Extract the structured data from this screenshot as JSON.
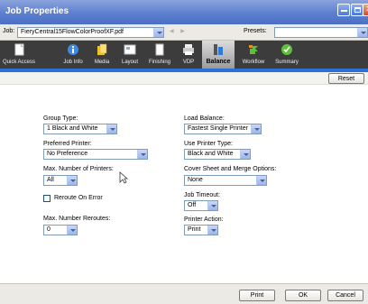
{
  "window": {
    "title": "Job Properties"
  },
  "jobrow": {
    "job_label": "Job:",
    "job_value": "FieryCentral15FlowColorProofXF.pdf",
    "presets_label": "Presets:",
    "presets_value": ""
  },
  "toolbar": {
    "tabs": [
      {
        "label": "Quick Access",
        "icon": "quick-access-icon"
      },
      {
        "label": "Job Info",
        "icon": "info-icon"
      },
      {
        "label": "Media",
        "icon": "media-icon"
      },
      {
        "label": "Layout",
        "icon": "layout-icon"
      },
      {
        "label": "Finishing",
        "icon": "finishing-icon"
      },
      {
        "label": "VDP",
        "icon": "printer-icon"
      },
      {
        "label": "Balance",
        "icon": "balance-icon",
        "active": true
      },
      {
        "label": "Workflow",
        "icon": "workflow-icon"
      },
      {
        "label": "Summary",
        "icon": "summary-check-icon"
      }
    ]
  },
  "reset_label": "Reset",
  "form": {
    "group_type": {
      "label": "Group Type:",
      "value": "1 Black and White"
    },
    "preferred_printer": {
      "label": "Preferred Printer:",
      "value": "No Preference"
    },
    "max_printers": {
      "label": "Max. Number of Printers:",
      "value": "All"
    },
    "reroute": {
      "label": "Reroute On Error",
      "checked": false
    },
    "max_reroutes": {
      "label": "Max. Number Reroutes:",
      "value": "0"
    },
    "load_balance": {
      "label": "Load Balance:",
      "value": "Fastest Single Printer"
    },
    "use_printer_type": {
      "label": "Use Printer Type:",
      "value": "Black and White"
    },
    "cover_sheet": {
      "label": "Cover Sheet and Merge Options:",
      "value": "None"
    },
    "job_timeout": {
      "label": "Job Timeout:",
      "value": "Off"
    },
    "printer_action": {
      "label": "Printer Action:",
      "value": "Print"
    }
  },
  "buttons": {
    "print": "Print",
    "ok": "OK",
    "cancel": "Cancel"
  },
  "colors": {
    "title_bar": "#5c7fcf",
    "toolbar": "#3c3c3c",
    "accent_strip": "#2d6fd6"
  }
}
